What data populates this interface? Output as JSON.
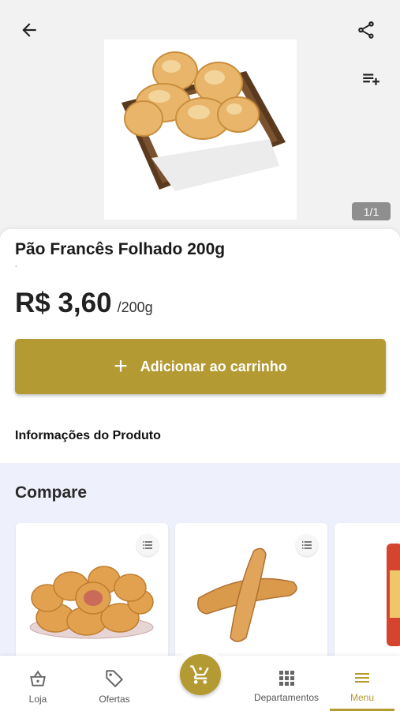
{
  "hero": {
    "pager": "1/1"
  },
  "product": {
    "title": "Pão Francês Folhado 200g",
    "subtitle": "-",
    "price": "R$ 3,60",
    "unit": "/200g",
    "add_to_cart_label": "Adicionar ao carrinho",
    "info_heading": "Informações do Produto"
  },
  "compare": {
    "title": "Compare"
  },
  "nav": {
    "items": [
      {
        "label": "Loja",
        "icon": "basket-icon"
      },
      {
        "label": "Ofertas",
        "icon": "tag-icon"
      },
      {
        "label": "Departamentos",
        "icon": "grid-icon"
      },
      {
        "label": "Menu",
        "icon": "menu-icon"
      }
    ],
    "active": "Menu"
  },
  "colors": {
    "accent": "#b39a32",
    "compare_bg": "#eef0fb",
    "pager_bg": "#8e8e8e"
  }
}
